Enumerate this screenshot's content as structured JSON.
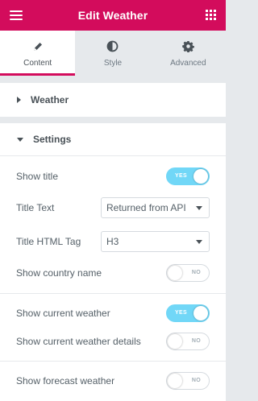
{
  "header": {
    "title": "Edit Weather",
    "menu_icon": "hamburger-icon",
    "apps_icon": "grid-icon"
  },
  "tabs": [
    {
      "label": "Content",
      "icon": "pencil-icon",
      "active": true
    },
    {
      "label": "Style",
      "icon": "half-circle-icon",
      "active": false
    },
    {
      "label": "Advanced",
      "icon": "gear-icon",
      "active": false
    }
  ],
  "sections": {
    "weather": {
      "label": "Weather",
      "expanded": false
    },
    "settings": {
      "label": "Settings",
      "expanded": true
    }
  },
  "controls": {
    "show_title": {
      "label": "Show title",
      "state": "YES"
    },
    "title_text": {
      "label": "Title Text",
      "value": "Returned from API"
    },
    "title_tag": {
      "label": "Title HTML Tag",
      "value": "H3"
    },
    "show_country": {
      "label": "Show country name",
      "state": "NO"
    },
    "show_current": {
      "label": "Show current weather",
      "state": "YES"
    },
    "show_current_details": {
      "label": "Show current weather details",
      "state": "NO"
    },
    "show_forecast": {
      "label": "Show forecast weather",
      "state": "NO"
    }
  },
  "colors": {
    "accent": "#d30c5c",
    "toggle_on": "#71d7f7",
    "panel_bg": "#e6e9ec"
  }
}
